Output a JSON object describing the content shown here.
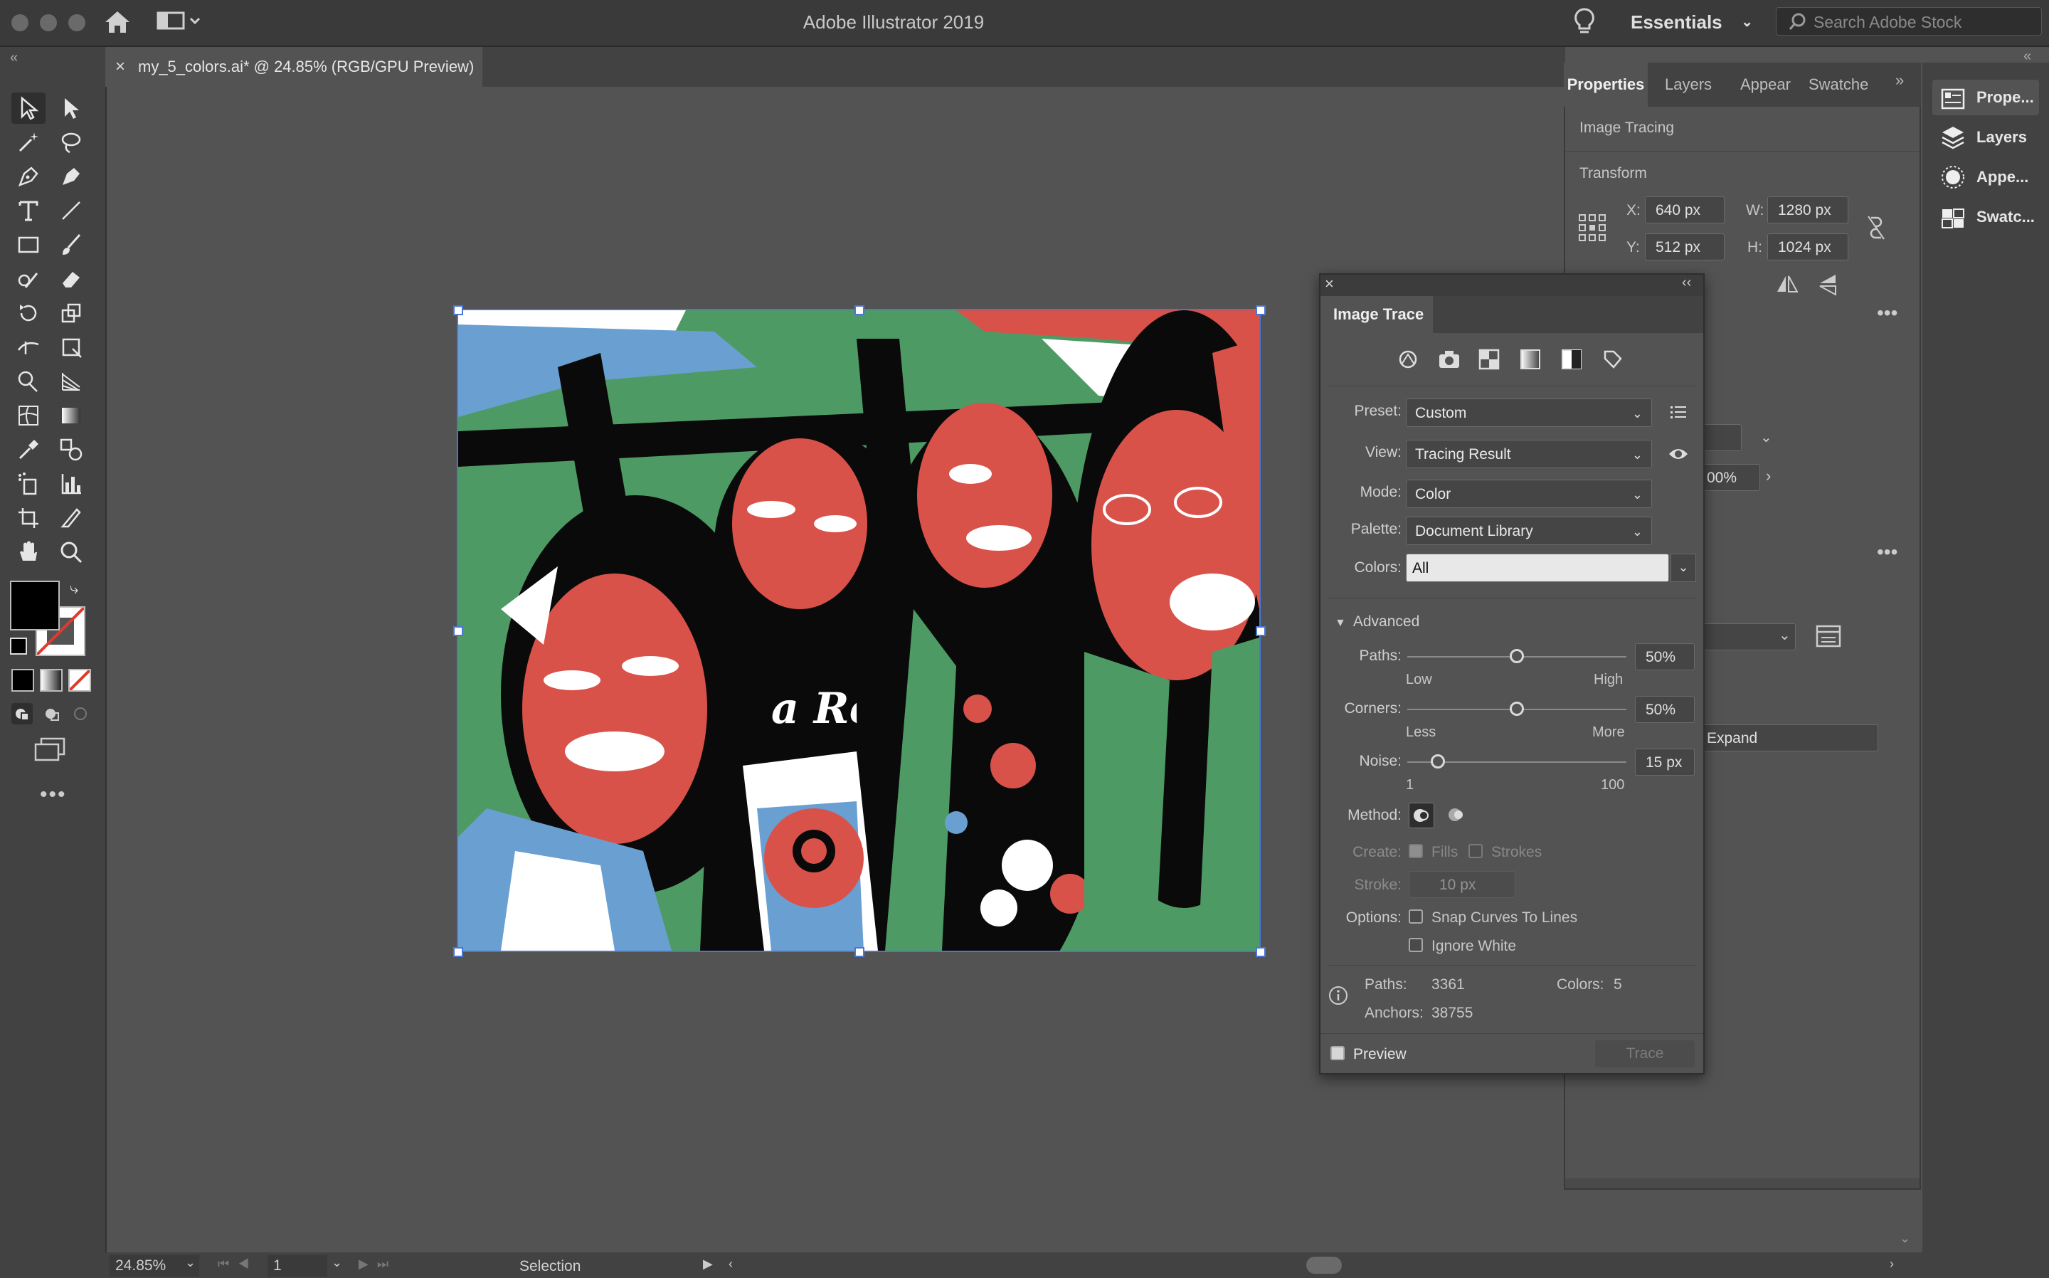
{
  "window": {
    "title": "Adobe Illustrator 2019"
  },
  "header": {
    "workspace_label": "Essentials",
    "search_placeholder": "Search Adobe Stock"
  },
  "document": {
    "tab_title": "my_5_colors.ai* @ 24.85% (RGB/GPU Preview)",
    "shirt_text": "a Rosa"
  },
  "props_panel": {
    "tabs": [
      "Properties",
      "Layers",
      "Appear",
      "Swatche"
    ],
    "section_image_tracing": "Image Tracing",
    "section_transform": "Transform",
    "x_label": "X:",
    "x_value": "640 px",
    "y_label": "Y:",
    "y_value": "512 px",
    "w_label": "W:",
    "w_value": "1280 px",
    "h_label": "H:",
    "h_value": "1024 px",
    "partial_opacity": "00%",
    "expand_button": "Expand"
  },
  "collapsed_dock": {
    "items": [
      "Prope...",
      "Layers",
      "Appe...",
      "Swatc..."
    ]
  },
  "image_trace": {
    "title": "Image Trace",
    "preset_label": "Preset:",
    "preset_value": "Custom",
    "view_label": "View:",
    "view_value": "Tracing Result",
    "mode_label": "Mode:",
    "mode_value": "Color",
    "palette_label": "Palette:",
    "palette_value": "Document Library",
    "colors_label": "Colors:",
    "colors_value": "All",
    "advanced_label": "Advanced",
    "paths_label": "Paths:",
    "paths_value": "50%",
    "paths_low": "Low",
    "paths_high": "High",
    "paths_level": 0.5,
    "corners_label": "Corners:",
    "corners_value": "50%",
    "corners_low": "Less",
    "corners_high": "More",
    "corners_level": 0.5,
    "noise_label": "Noise:",
    "noise_value": "15 px",
    "noise_low": "1",
    "noise_high": "100",
    "noise_level": 0.14,
    "method_label": "Method:",
    "create_label": "Create:",
    "fills_label": "Fills",
    "strokes_label": "Strokes",
    "stroke_label": "Stroke:",
    "stroke_value": "10 px",
    "options_label": "Options:",
    "snap_label": "Snap Curves To Lines",
    "ignore_white_label": "Ignore White",
    "stats_paths_label": "Paths:",
    "stats_paths_value": "3361",
    "stats_colors_label": "Colors:",
    "stats_colors_value": "5",
    "stats_anchors_label": "Anchors:",
    "stats_anchors_value": "38755",
    "preview_label": "Preview",
    "trace_button": "Trace"
  },
  "status": {
    "zoom": "24.85%",
    "artboard_num": "1",
    "tool": "Selection"
  },
  "colors": {
    "trace_red": "#d8524a",
    "trace_green": "#4e9a64",
    "trace_blue": "#6a9fd2",
    "selection_blue": "#4a76d8"
  }
}
